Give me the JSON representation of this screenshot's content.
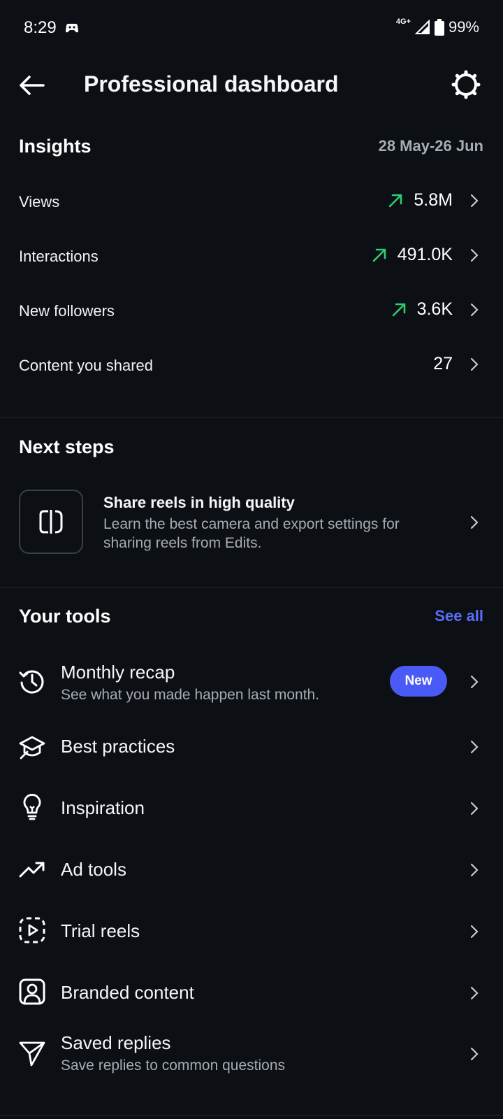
{
  "status_bar": {
    "time": "8:29",
    "network": "4G+",
    "battery": "99%"
  },
  "header": {
    "title": "Professional dashboard"
  },
  "insights": {
    "title": "Insights",
    "date_range": "28 May-26 Jun",
    "metrics": [
      {
        "label": "Views",
        "value": "5.8M",
        "trend": "up"
      },
      {
        "label": "Interactions",
        "value": "491.0K",
        "trend": "up"
      },
      {
        "label": "New followers",
        "value": "3.6K",
        "trend": "up"
      },
      {
        "label": "Content you shared",
        "value": "27",
        "trend": "none"
      }
    ]
  },
  "next_steps": {
    "title": "Next steps",
    "card": {
      "title": "Share reels in high quality",
      "description": "Learn the best camera and export settings for sharing reels from Edits."
    }
  },
  "tools": {
    "title": "Your tools",
    "see_all": "See all",
    "items": [
      {
        "label": "Monthly recap",
        "sub": "See what you made happen last month.",
        "badge": "New",
        "icon": "history-icon"
      },
      {
        "label": "Best practices",
        "icon": "graduation-cap-icon"
      },
      {
        "label": "Inspiration",
        "icon": "lightbulb-icon"
      },
      {
        "label": "Ad tools",
        "icon": "trend-up-icon"
      },
      {
        "label": "Trial reels",
        "icon": "trial-reels-icon"
      },
      {
        "label": "Branded content",
        "icon": "branded-content-icon"
      },
      {
        "label": "Saved replies",
        "sub": "Save replies to common questions",
        "icon": "paper-plane-icon"
      }
    ]
  },
  "colors": {
    "background": "#0c0f14",
    "accent": "#5b6cf9",
    "trend_up": "#2ecc71",
    "badge": "#4a5af6"
  }
}
